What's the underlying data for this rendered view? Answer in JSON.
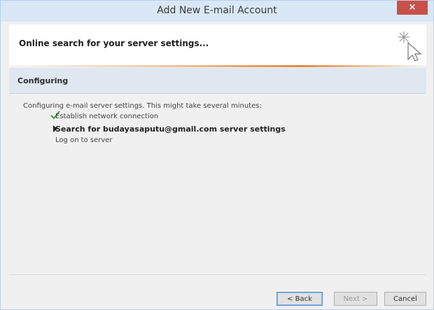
{
  "window": {
    "title": "Add New E-mail Account",
    "close_label": "×"
  },
  "header": {
    "text": "Online search for your server settings..."
  },
  "section": {
    "title": "Configuring"
  },
  "content": {
    "intro": "Configuring e-mail server settings. This might take several minutes:",
    "steps": [
      {
        "label": "Establish network connection",
        "status": "done",
        "icon": "check-icon"
      },
      {
        "label": "Search for budayasaputu@gmail.com server settings",
        "status": "in-progress",
        "icon": "arrow-icon"
      },
      {
        "label": "Log on to server",
        "status": "pending",
        "icon": ""
      }
    ]
  },
  "footer": {
    "back_label": "< Back",
    "next_label": "Next >",
    "cancel_label": "Cancel"
  },
  "colors": {
    "titlebar": "#d9e7f6",
    "close_button": "#c7504a",
    "accent": "#e58a3c",
    "check": "#3a9b3a"
  }
}
